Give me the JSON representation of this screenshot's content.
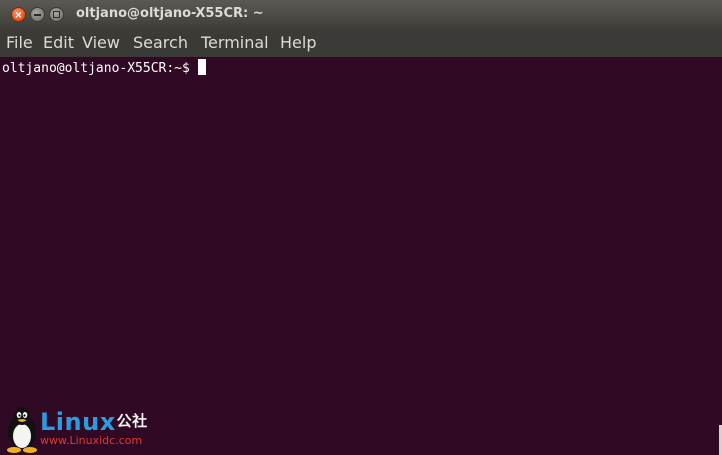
{
  "window": {
    "title": "oltjano@oltjano-X55CR: ~",
    "controls": {
      "close_glyph": "×",
      "close_icon": "close-icon",
      "minimize_icon": "minimize-icon",
      "maximize_icon": "maximize-icon"
    }
  },
  "menubar": {
    "items": [
      "File",
      "Edit",
      "View",
      "Search",
      "Terminal",
      "Help"
    ]
  },
  "terminal": {
    "prompt": "oltjano@oltjano-X55CR:~$",
    "background": "#300a24",
    "foreground": "#ffffff"
  },
  "watermark": {
    "brand": "Linux",
    "brand_cn": "公社",
    "url": "www.Linuxidc.com",
    "logo_icon": "tux-penguin-icon"
  }
}
